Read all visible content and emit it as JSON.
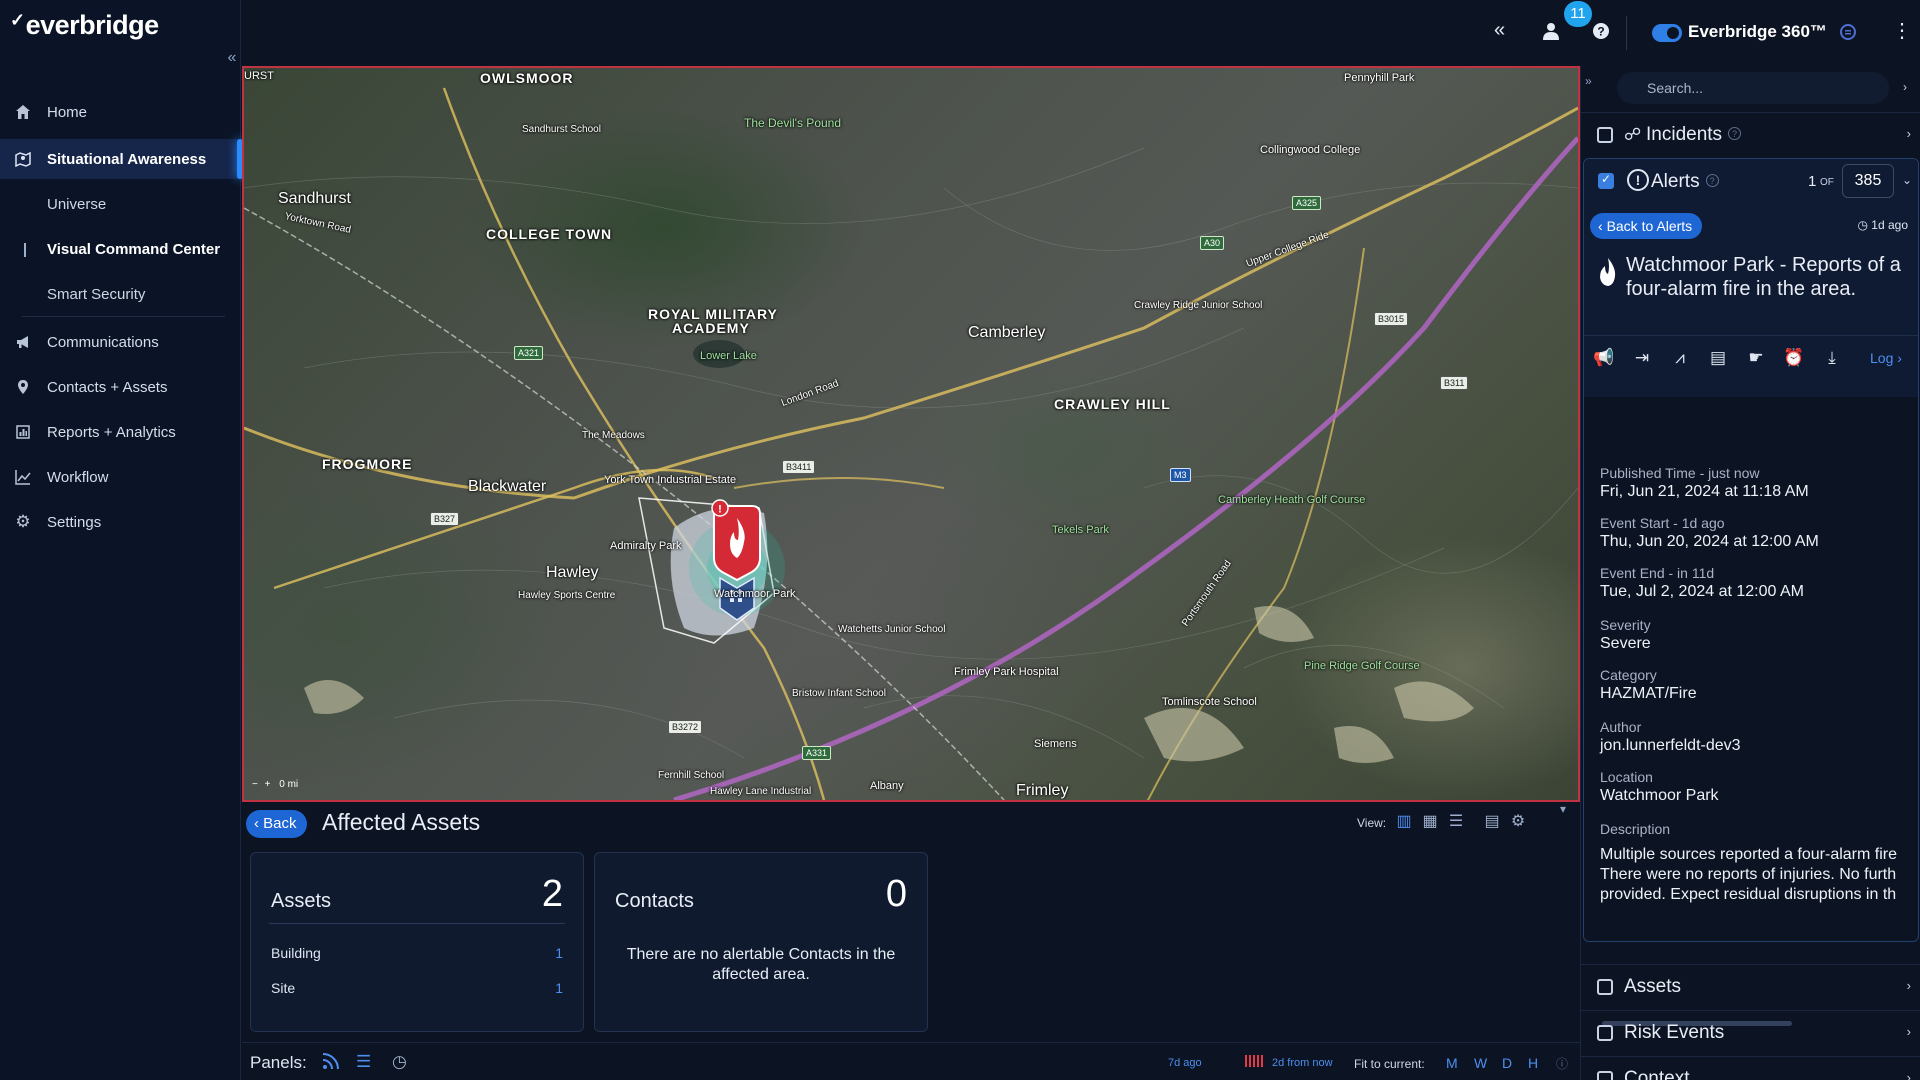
{
  "brand": {
    "logo": "everbridge",
    "product": "Everbridge 360™"
  },
  "sidebar": {
    "items": [
      {
        "label": "Home",
        "icon": "home-icon"
      },
      {
        "label": "Situational Awareness",
        "icon": "map-icon"
      },
      {
        "label": "Communications",
        "icon": "megaphone-icon"
      },
      {
        "label": "Contacts + Assets",
        "icon": "location-pin-icon"
      },
      {
        "label": "Reports + Analytics",
        "icon": "bar-chart-icon"
      },
      {
        "label": "Workflow",
        "icon": "line-chart-icon"
      },
      {
        "label": "Settings",
        "icon": "gear-icon"
      }
    ],
    "sub_items": [
      "Universe",
      "Visual Command Center",
      "Smart Security"
    ]
  },
  "topbar": {
    "notification_count": "11",
    "accent": "#21a4ee"
  },
  "map": {
    "labels": [
      "OWLSMOOR",
      "COLLEGE TOWN",
      "ROYAL MILITARY",
      "ACADEMY",
      "Camberley",
      "CRAWLEY HILL",
      "FROGMORE",
      "Blackwater",
      "Hawley",
      "Frimley",
      "Sandhurst",
      "The Devil's Pound",
      "Pennyhill Park",
      "Pine Ridge Golf Course",
      "Tekels Park",
      "Watchmoor Park",
      "Lower Lake",
      "Camberley Heath Golf Course",
      "Collingwood College",
      "York Town Industrial Estate",
      "Admiralty Park",
      "Frimley Park Hospital",
      "Tomlinscote School",
      "Siemens",
      "Albany",
      "URST",
      "Sandhurst School",
      "The Meadows",
      "Watchetts Junior School",
      "Bristow Infant School",
      "Hawley Sports Centre",
      "Crawley Ridge Junior School",
      "Fernhill School",
      "Hawley Lane Industrial"
    ],
    "roads": [
      "A30",
      "A321",
      "A325",
      "B3015",
      "B3411",
      "B311",
      "B327",
      "B3272",
      "A331",
      "M3",
      "Portsmouth Road",
      "London Road",
      "Yorktown Road",
      "College Ride",
      "Upper College Ride"
    ],
    "scale": "0 mi"
  },
  "bottom": {
    "back_label": "Back",
    "title": "Affected Assets",
    "view_label": "View:",
    "assets": {
      "title": "Assets",
      "count": "2",
      "rows": [
        {
          "label": "Building",
          "value": "1"
        },
        {
          "label": "Site",
          "value": "1"
        }
      ]
    },
    "contacts": {
      "title": "Contacts",
      "count": "0",
      "empty": "There are no alertable Contacts in the affected area."
    },
    "panels_label": "Panels:",
    "time_start": "7d ago",
    "time_end": "2d from now",
    "fit_label": "Fit to current:",
    "fit_options": [
      "M",
      "W",
      "D",
      "H"
    ]
  },
  "right": {
    "search_placeholder": "Search...",
    "incidents": "Incidents",
    "alerts": "Alerts",
    "page_current": "1",
    "page_of": "OF",
    "page_total": "385",
    "back_to_alerts": "Back to Alerts",
    "ago": "1d ago",
    "alert_title": "Watchmoor Park - Reports of a four-alarm fire in the area.",
    "log_label": "Log",
    "fields": [
      {
        "label": "Published Time - just now",
        "value": "Fri, Jun 21, 2024 at 11:18 AM"
      },
      {
        "label": "Event Start - 1d ago",
        "value": "Thu, Jun 20, 2024 at 12:00 AM"
      },
      {
        "label": "Event End - in 11d",
        "value": "Tue, Jul 2, 2024 at 12:00 AM"
      },
      {
        "label": "Severity",
        "value": "Severe"
      },
      {
        "label": "Category",
        "value": "HAZMAT/Fire"
      },
      {
        "label": "Author",
        "value": "jon.lunnerfeldt-dev3"
      },
      {
        "label": "Location",
        "value": "Watchmoor Park"
      }
    ],
    "description_label": "Description",
    "description_lines": [
      "Multiple sources reported a four-alarm fire",
      "There were no reports of injuries. No furth",
      "provided. Expect residual disruptions in th"
    ],
    "sections": [
      "Assets",
      "Risk Events",
      "Context"
    ]
  }
}
